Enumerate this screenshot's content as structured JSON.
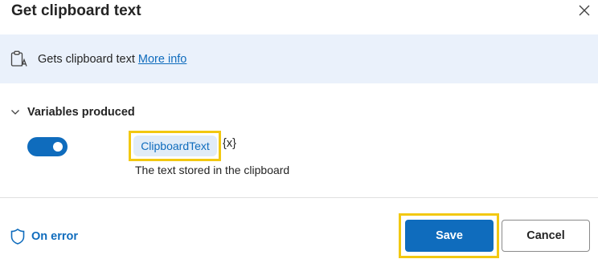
{
  "dialog": {
    "title": "Get clipboard text",
    "close_icon": "close-icon"
  },
  "info": {
    "icon": "clipboard-text-icon",
    "text": "Gets clipboard text",
    "link_label": "More info"
  },
  "variables": {
    "section_label": "Variables produced",
    "expanded": true,
    "toggle_on": true,
    "variable_name": "ClipboardText",
    "variable_brace": "{x}",
    "variable_description": "The text stored in the clipboard"
  },
  "footer": {
    "on_error_label": "On error",
    "on_error_icon": "shield-icon",
    "save_label": "Save",
    "cancel_label": "Cancel"
  },
  "colors": {
    "accent": "#0f6cbd",
    "info_bar_bg": "#eaf1fb",
    "highlight": "#f2c811",
    "chip_bg": "#e1ecf8"
  }
}
